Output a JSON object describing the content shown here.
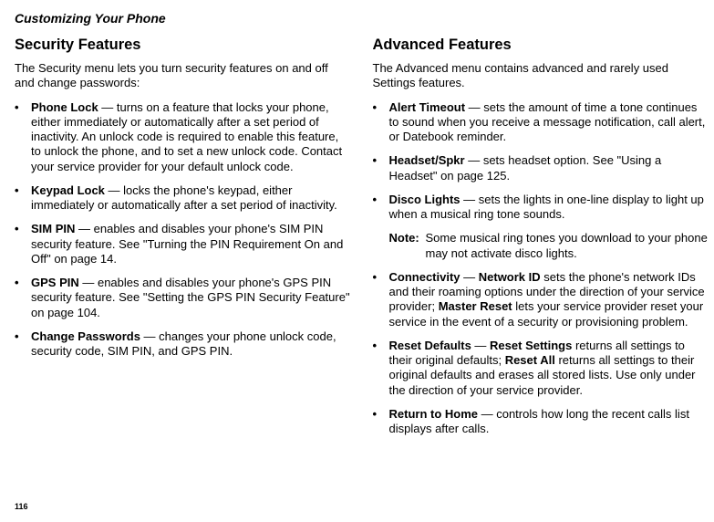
{
  "header": "Customizing Your Phone",
  "pageNumber": "116",
  "left": {
    "title": "Security Features",
    "intro": "The Security menu lets you turn security features on and off and change passwords:",
    "items": [
      {
        "label": "Phone Lock",
        "text": " — turns on a feature that locks your phone, either immediately or automatically after a set period of inactivity. An unlock code is required to enable this feature, to unlock the phone, and to set a new unlock code. Contact your service provider for your default unlock code."
      },
      {
        "label": "Keypad Lock",
        "text": " — locks the phone's keypad, either immediately or automatically after a set period of inactivity."
      },
      {
        "label": "SIM PIN",
        "text": " — enables and disables your phone's SIM PIN security feature. See \"Turning the PIN Requirement On and Off\" on page 14."
      },
      {
        "label": "GPS PIN",
        "text": " — enables and disables your phone's GPS PIN security feature. See \"Setting the GPS PIN Security Feature\" on page 104."
      },
      {
        "label": "Change Passwords",
        "text": " — changes your phone unlock code, security code, SIM PIN, and GPS PIN."
      }
    ]
  },
  "right": {
    "title": "Advanced Features",
    "intro": "The Advanced menu contains advanced and rarely used Settings features.",
    "items": [
      {
        "label": "Alert Timeout",
        "text": " — sets the amount of time a tone continues to sound when you receive a message notification, call alert, or Datebook reminder."
      },
      {
        "label": "Headset/Spkr",
        "text": " — sets headset option. See \"Using a Headset\" on page 125."
      },
      {
        "label": "Disco Lights",
        "text": " — sets the lights in one-line display to light up when a musical ring tone sounds."
      }
    ],
    "note": {
      "label": "Note:",
      "text": " Some musical ring tones you download to your phone may not activate disco lights."
    },
    "items2": [
      {
        "label": "Connectivity",
        "mid1": " — ",
        "bold2": "Network ID",
        "text2": " sets the phone's network IDs and their roaming options under the direction of your service provider; ",
        "bold3": "Master Reset",
        "text3": " lets your service provider reset your service in the event of a security or provisioning problem."
      },
      {
        "label": "Reset Defaults",
        "mid1": " — ",
        "bold2": "Reset Settings",
        "text2": " returns all settings to their original defaults; ",
        "bold3": "Reset All",
        "text3": " returns all settings to their original defaults and erases all stored lists. Use only under the direction of your service provider."
      },
      {
        "label": "Return to Home",
        "text": " — controls how long the recent calls list displays after calls."
      }
    ]
  }
}
